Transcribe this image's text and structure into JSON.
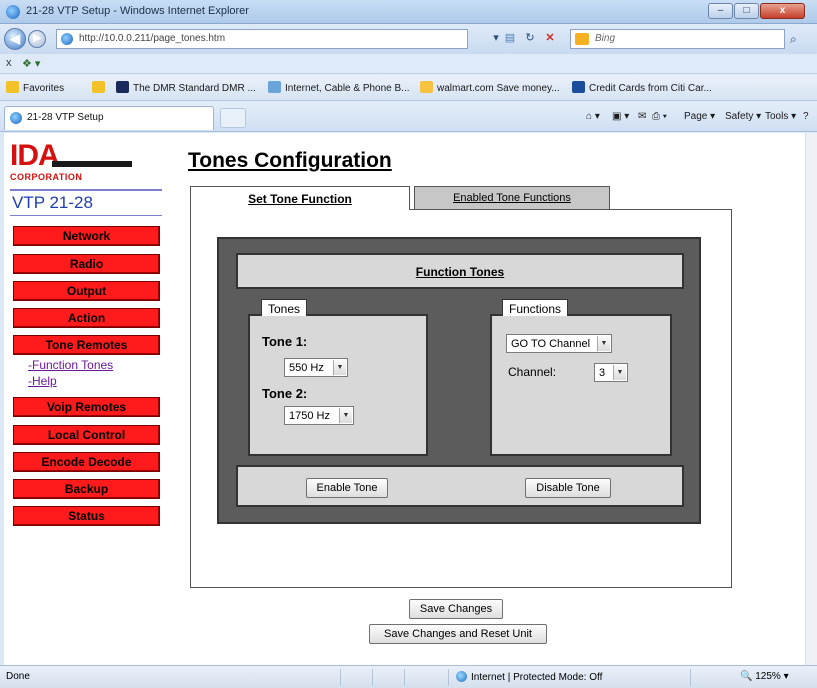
{
  "window": {
    "title": "21-28 VTP Setup - Windows Internet Explorer",
    "minimize": "–",
    "maximize": "□",
    "close": "x"
  },
  "addressbar": {
    "url": "http://10.0.0.211/page_tones.htm",
    "search_placeholder": "Bing"
  },
  "favorites": {
    "label": "Favorites",
    "items": [
      {
        "label": "The DMR Standard  DMR ...",
        "icon": "dmr-icon",
        "color": "#1a2a5a"
      },
      {
        "label": "Internet, Cable & Phone B...",
        "icon": "cable-icon",
        "color": "#6aa4d8"
      },
      {
        "label": "walmart.com Save money...",
        "icon": "walmart-icon",
        "color": "#f6c342"
      },
      {
        "label": "Credit Cards from Citi Car...",
        "icon": "citi-icon",
        "color": "#1b4f9c"
      }
    ]
  },
  "browser_tab": {
    "label": "21-28 VTP Setup"
  },
  "command_bar": {
    "page": "Page ▾",
    "safety": "Safety ▾",
    "tools": "Tools ▾"
  },
  "logo": {
    "brand": "IDA",
    "subtitle": "CORPORATION"
  },
  "sidebar": {
    "model": "VTP 21-28",
    "items": [
      {
        "label": "Network"
      },
      {
        "label": "Radio"
      },
      {
        "label": "Output"
      },
      {
        "label": "Action"
      },
      {
        "label": "Tone Remotes"
      },
      {
        "label": "Voip Remotes"
      },
      {
        "label": "Local Control"
      },
      {
        "label": "Encode Decode"
      },
      {
        "label": "Backup"
      },
      {
        "label": "Status"
      }
    ],
    "sublinks": [
      {
        "label": "-Function Tones"
      },
      {
        "label": "-Help"
      }
    ]
  },
  "main": {
    "title": "Tones Configuration",
    "tabs": [
      {
        "label": "Set Tone Function",
        "active": true
      },
      {
        "label": "Enabled Tone Functions",
        "active": false
      }
    ],
    "panel_header": "Function Tones",
    "tones_group": {
      "label": "Tones",
      "tone1_label": "Tone 1:",
      "tone1_value": "550 Hz",
      "tone2_label": "Tone 2:",
      "tone2_value": "1750 Hz"
    },
    "functions_group": {
      "label": "Functions",
      "function_value": "GO TO Channel",
      "channel_label": "Channel:",
      "channel_value": "3"
    },
    "enable_button": "Enable Tone",
    "disable_button": "Disable Tone",
    "save_button": "Save Changes",
    "save_reset_button": "Save Changes and Reset Unit"
  },
  "statusbar": {
    "status": "Done",
    "zone": "Internet | Protected Mode: Off",
    "zoom": "125%"
  },
  "colors": {
    "nav_button": "#ff1b1b",
    "model_text": "#1f3eb0",
    "panel_dark": "#5c5c5c",
    "panel_light": "#d8d8d8"
  }
}
